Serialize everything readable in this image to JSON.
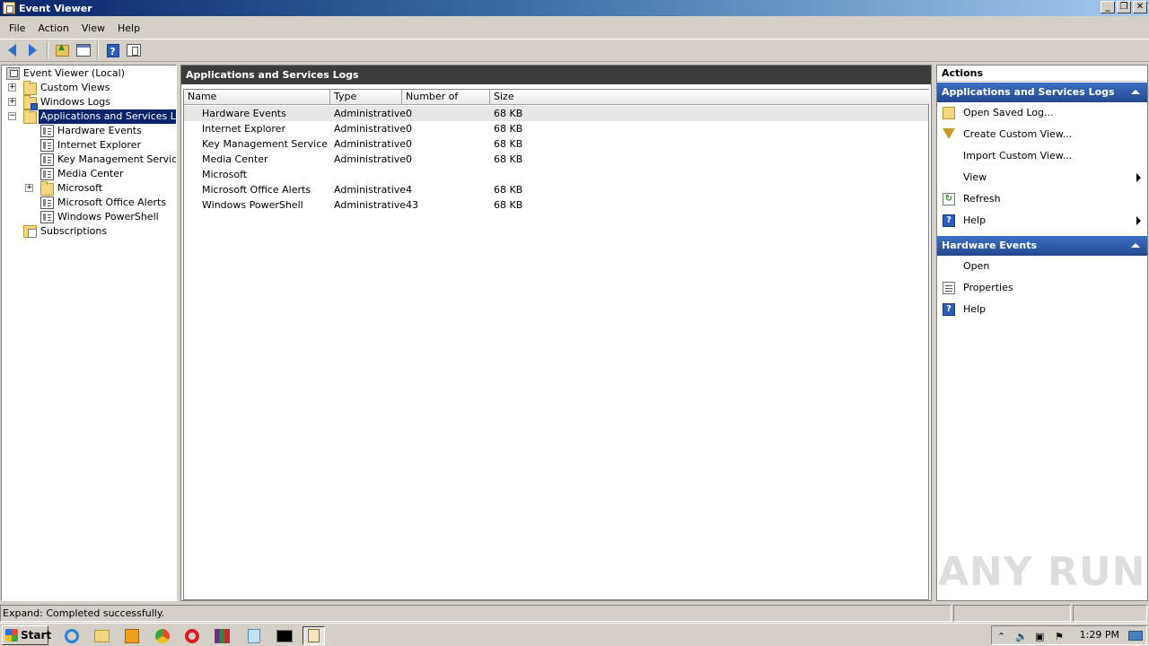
{
  "window": {
    "title": "Event Viewer",
    "controls": [
      "_",
      "❐",
      "✕"
    ]
  },
  "menu": [
    "File",
    "Action",
    "View",
    "Help"
  ],
  "tree": {
    "root": "Event Viewer (Local)",
    "items": [
      {
        "label": "Custom Views"
      },
      {
        "label": "Windows Logs"
      },
      {
        "label": "Applications and Services Logs"
      },
      {
        "label": "Hardware Events"
      },
      {
        "label": "Internet Explorer"
      },
      {
        "label": "Key Management Service"
      },
      {
        "label": "Media Center"
      },
      {
        "label": "Microsoft"
      },
      {
        "label": "Microsoft Office Alerts"
      },
      {
        "label": "Windows PowerShell"
      },
      {
        "label": "Subscriptions"
      }
    ],
    "expander_plus": "+",
    "expander_minus": "−"
  },
  "center": {
    "title": "Applications and Services Logs",
    "columns": [
      "Name",
      "Type",
      "Number of Events",
      "Size"
    ],
    "rows": [
      {
        "name": "Hardware Events",
        "type": "Administrative",
        "events": "0",
        "size": "68 KB"
      },
      {
        "name": "Internet Explorer",
        "type": "Administrative",
        "events": "0",
        "size": "68 KB"
      },
      {
        "name": "Key Management Service",
        "type": "Administrative",
        "events": "0",
        "size": "68 KB"
      },
      {
        "name": "Media Center",
        "type": "Administrative",
        "events": "0",
        "size": "68 KB"
      },
      {
        "name": "Microsoft",
        "type": "",
        "events": "",
        "size": ""
      },
      {
        "name": "Microsoft Office Alerts",
        "type": "Administrative",
        "events": "4",
        "size": "68 KB"
      },
      {
        "name": "Windows PowerShell",
        "type": "Administrative",
        "events": "43",
        "size": "68 KB"
      }
    ]
  },
  "actions": {
    "title": "Actions",
    "section1": {
      "header": "Applications and Services Logs",
      "items": [
        "Open Saved Log...",
        "Create Custom View...",
        "Import Custom View...",
        "View",
        "Refresh",
        "Help"
      ]
    },
    "section2": {
      "header": "Hardware Events",
      "items": [
        "Open",
        "Properties",
        "Help"
      ]
    }
  },
  "status": {
    "text": "Expand:  Completed successfully."
  },
  "taskbar": {
    "start": "Start",
    "clock": "1:29 PM"
  },
  "watermark": "ANY RUN",
  "icons": {
    "help_glyph": "?",
    "refresh_glyph": "↻"
  }
}
